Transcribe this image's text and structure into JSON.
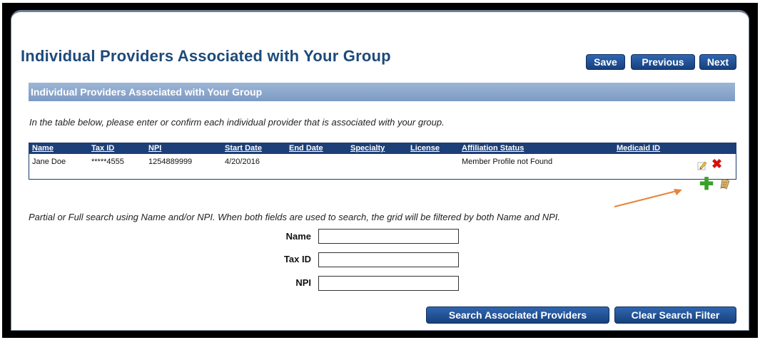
{
  "page": {
    "title": "Individual Providers Associated with Your Group"
  },
  "toolbar": {
    "save_label": "Save",
    "previous_label": "Previous",
    "next_label": "Next"
  },
  "section": {
    "header": "Individual Providers Associated with Your Group",
    "instruction": "In the table below, please enter or confirm each individual provider that is associated with your group."
  },
  "grid": {
    "columns": [
      "Name",
      "Tax ID",
      "NPI",
      "Start Date",
      "End Date",
      "Specialty",
      "License",
      "Affiliation Status",
      "Medicaid ID"
    ],
    "rows": [
      [
        "Jane Doe",
        "*****4555",
        "1254889999",
        "4/20/2016",
        "",
        "",
        "",
        "Member Profile not Found",
        ""
      ]
    ],
    "icons": [
      "edit-icon",
      "delete-icon",
      "add-icon",
      "scroll-icon"
    ],
    "header_color": "#1d3f78"
  },
  "search": {
    "hint": "Partial or Full search using Name and/or NPI. When both fields are used to search, the grid will be filtered by both Name and NPI.",
    "name_label": "Name",
    "name_value": "",
    "taxid_label": "Tax ID",
    "taxid_value": "",
    "npi_label": "NPI",
    "npi_value": "",
    "search_button": "Search Associated Providers",
    "clear_button": "Clear Search Filter"
  },
  "colors": {
    "title": "#1d4a7a",
    "button": "#1f4f93",
    "section_bar": "#8ca8cd",
    "arrow": "#e8833a",
    "delete": "#d6100b",
    "add": "#3aa12a"
  }
}
